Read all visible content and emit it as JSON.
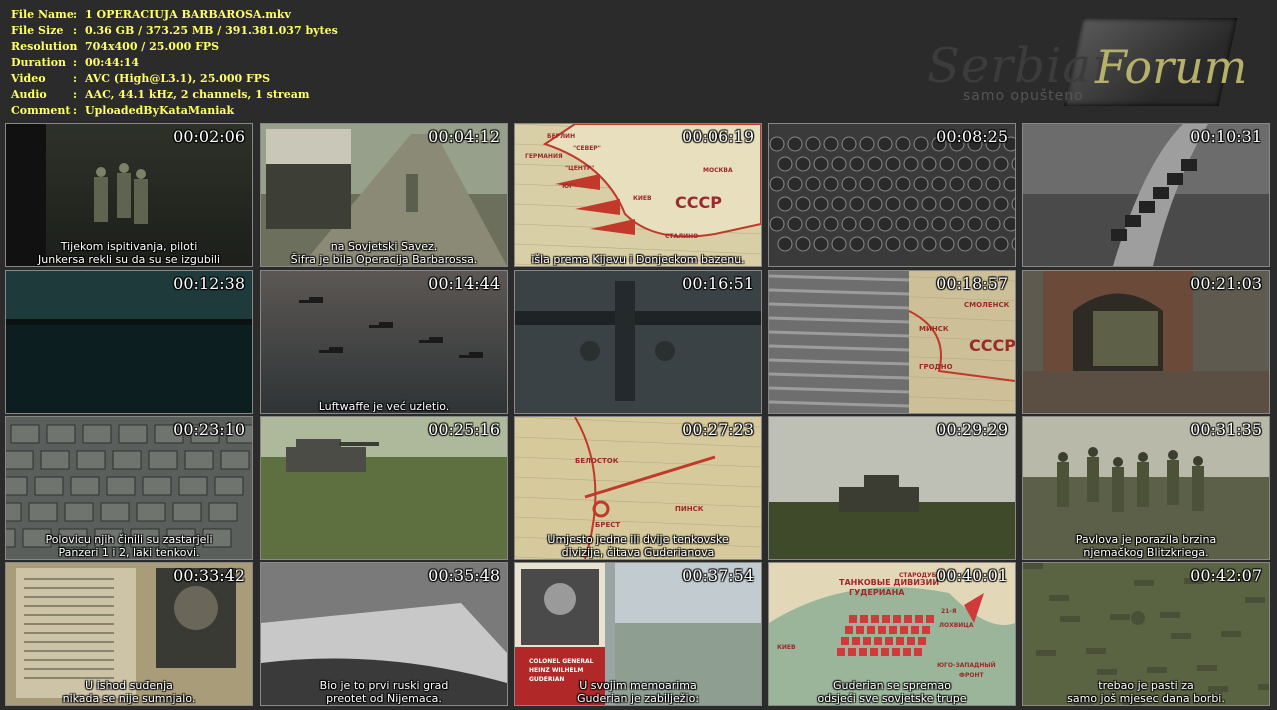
{
  "info": [
    {
      "key": "File Name",
      "value": "1 OPERACIUJA BARBAROSA.mkv"
    },
    {
      "key": "File Size",
      "value": "0.36 GB  / 373.25 MB  / 391.381.037  bytes"
    },
    {
      "key": "Resolution",
      "value": "704x400 / 25.000 FPS"
    },
    {
      "key": "Duration",
      "value": "00:44:14"
    },
    {
      "key": "Video",
      "value": "AVC (High@L3.1), 25.000 FPS"
    },
    {
      "key": "Audio",
      "value": "AAC, 44.1 kHz, 2 channels, 1 stream"
    },
    {
      "key": "Comment",
      "value": "UploadedByKataManiak"
    }
  ],
  "info_separator": ":",
  "logo": {
    "word1": "Serbian",
    "word2": "Forum",
    "tagline": "samo opušteno"
  },
  "thumbnails": [
    {
      "time": "00:02:06",
      "sub": [
        "Tijekom ispitivanja, piloti",
        "Junkersa rekli su da su se izgubili"
      ],
      "bg": "#1c1f1a",
      "accent": "#4d5443"
    },
    {
      "time": "00:04:12",
      "sub": [
        "na Sovjetski Savez.",
        "Šifra je bila Operacija Barbarossa."
      ],
      "bg": "#6b6f5c",
      "accent": "#a8a796"
    },
    {
      "time": "00:06:19",
      "sub": [
        "išla prema Kijevu i Donjeckom bazenu."
      ],
      "bg": "#d8cfa7",
      "accent": "#c03a3a"
    },
    {
      "time": "00:08:25",
      "sub": [],
      "bg": "#3a3a3a",
      "accent": "#9a9a9a"
    },
    {
      "time": "00:10:31",
      "sub": [],
      "bg": "#4a4a4a",
      "accent": "#c9c9c9"
    },
    {
      "time": "00:12:38",
      "sub": [],
      "bg": "#0f1d1a",
      "accent": "#3f6b66"
    },
    {
      "time": "00:14:44",
      "sub": [
        "Luftwaffe je već uzletio."
      ],
      "bg": "#2e3436",
      "accent": "#8a7a72"
    },
    {
      "time": "00:16:51",
      "sub": [],
      "bg": "#3b4245",
      "accent": "#6d7675"
    },
    {
      "time": "00:18:57",
      "sub": [],
      "bg": "#cdbf98",
      "accent": "#b83b3b"
    },
    {
      "time": "00:21:03",
      "sub": [],
      "bg": "#5e5a50",
      "accent": "#857560"
    },
    {
      "time": "00:23:10",
      "sub": [
        "Polovicu njih činili su zastarjeli",
        "Panzeri 1 i 2, laki tenkovi."
      ],
      "bg": "#5a5f5c",
      "accent": "#a3a9a4"
    },
    {
      "time": "00:25:16",
      "sub": [],
      "bg": "#5f7040",
      "accent": "#505548"
    },
    {
      "time": "00:27:23",
      "sub": [
        "Umjesto jedne ili dvije tenkovske",
        "divizije, čitava Guderianova"
      ],
      "bg": "#d6c99c",
      "accent": "#c23b3b"
    },
    {
      "time": "00:29:29",
      "sub": [],
      "bg": "#8f9285",
      "accent": "#3f4e2a"
    },
    {
      "time": "00:31:35",
      "sub": [
        "Pavlova je porazila brzina",
        "njemačkog Blitzkriega."
      ],
      "bg": "#5c6048",
      "accent": "#3a3c30"
    },
    {
      "time": "00:33:42",
      "sub": [
        "U ishod suđenja",
        "nikada se nije sumnjalo."
      ],
      "bg": "#a89c79",
      "accent": "#3a3a34"
    },
    {
      "time": "00:35:48",
      "sub": [
        "Bio je to prvi ruski grad",
        "preotet od Nijemaca."
      ],
      "bg": "#4e4e4e",
      "accent": "#bdbdbd"
    },
    {
      "time": "00:37:54",
      "sub": [
        "U svojim memoarima",
        "Guderian je zabilježio:"
      ],
      "bg": "#9aa6a4",
      "accent": "#b02828"
    },
    {
      "time": "00:40:01",
      "sub": [
        "Guderian se spremao",
        "odsjeći sve sovjetske trupe"
      ],
      "bg": "#c6d6c0",
      "accent": "#d03a3a"
    },
    {
      "time": "00:42:07",
      "sub": [
        "trebao je pasti za",
        "samo još mjesec dana borbi."
      ],
      "bg": "#4b5436",
      "accent": "#6d7452"
    }
  ],
  "map_labels": {
    "t3": [
      "БЕРЛИН",
      "ГЕРМАНИЯ",
      "\"СЕВЕР\"",
      "\"ЦЕНТР\"",
      "\"ЮГ\"",
      "МОСКВА",
      "КИЕВ",
      "СССР",
      "СТАЛИНО"
    ],
    "t9": [
      "СМОЛЕНСК",
      "МИНСК",
      "ГРОДНО",
      "СССР"
    ],
    "t13": [
      "БЕЛОСТОК",
      "БРЕСТ",
      "ПИНСК"
    ],
    "t18": [
      "COLONEL GENERAL",
      "HEINZ WILHELM",
      "GUDERIAN"
    ],
    "t19": [
      "ТАНКОВЫЕ ДИВИЗИИ",
      "ГУДЕРИАНА",
      "КИЕВ",
      "ЛОХВИЦА",
      "ЮГО-ЗАПАДНЫЙ",
      "ФРОНТ",
      "21-Я",
      "СТАРОДУБ"
    ]
  }
}
